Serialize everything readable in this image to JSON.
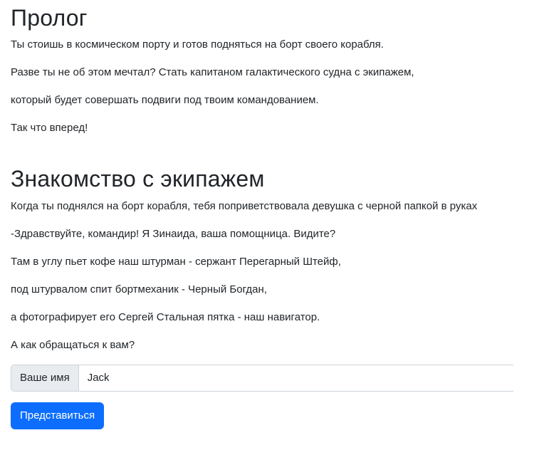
{
  "prolog": {
    "title": "Пролог",
    "paragraphs": [
      "Ты стоишь в космическом порту и готов подняться на борт своего корабля.",
      "Разве ты не об этом мечтал? Стать капитаном галактического судна с экипажем,",
      "который будет совершать подвиги под твоим командованием.",
      "Так что вперед!"
    ]
  },
  "crew": {
    "title": "Знакомство с экипажем",
    "paragraphs": [
      "Когда ты поднялся на борт корабля, тебя поприветствовала девушка с черной папкой в руках",
      "-Здравствуйте, командир! Я Зинаида, ваша помощница. Видите?",
      "Там в углу пьет кофе наш штурман - сержант Перегарный Штейф,",
      "под штурвалом спит бортмеханик - Черный Богдан,",
      "а фотографирует его Сергей Стальная пятка - наш навигатор.",
      "А как обращаться к вам?"
    ]
  },
  "form": {
    "name_label": "Ваше имя",
    "name_value": "Jack",
    "submit_label": "Представиться"
  },
  "colors": {
    "primary": "#0d6efd",
    "text": "#212529",
    "input_group_bg": "#e9ecef",
    "border": "#ced4da"
  }
}
